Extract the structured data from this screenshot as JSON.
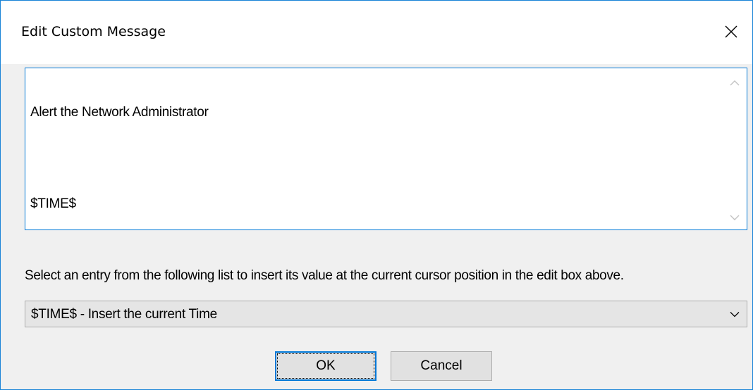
{
  "dialog": {
    "title": "Edit Custom Message",
    "close_icon": "close-icon"
  },
  "edit_box": {
    "lines": [
      "Alert the Network Administrator",
      "$TIME$"
    ],
    "scroll_up_icon": "chevron-up-icon",
    "scroll_down_icon": "chevron-down-icon"
  },
  "instruction": "Select an entry from the following list to insert its value at the current cursor position in the edit box above.",
  "combo": {
    "selected": "$TIME$ - Insert the current Time",
    "arrow_icon": "chevron-down-icon"
  },
  "buttons": {
    "ok_label": "OK",
    "cancel_label": "Cancel"
  },
  "colors": {
    "accent": "#0078d7",
    "window_border": "#1883d7",
    "dialog_bg": "#f0f0f0"
  }
}
